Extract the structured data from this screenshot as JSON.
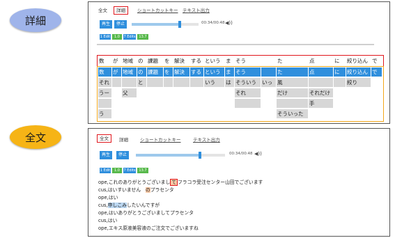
{
  "labels": {
    "detail": "詳細",
    "full": "全文"
  },
  "top": {
    "tabs": [
      "全文",
      "詳細",
      "ショートカットキー",
      "テキスト出力"
    ],
    "selected_tab": "詳細",
    "player": {
      "play": "再生",
      "stop": "停止",
      "time": "00:34/00:48",
      "progress": 0.72
    },
    "badges": [
      "1 Edit",
      "1.0 %",
      "7 Edits",
      "13.7 %"
    ],
    "tokens": [
      "数",
      "が",
      "地域",
      "の",
      "課題",
      "を",
      "解決",
      "する",
      "という",
      "ま",
      "そう",
      "",
      "た",
      "点",
      "に",
      "絞り込ん",
      "で"
    ],
    "grid": [
      [
        "数",
        "が",
        "地域",
        "の",
        "課題",
        "を",
        "解決",
        "する",
        "という",
        "ま",
        "そう",
        "",
        "た",
        "点",
        "に",
        "絞り込ん",
        "で"
      ],
      [
        "それ",
        "",
        "",
        "と",
        "",
        "",
        "",
        "",
        "いう",
        "は",
        "そういう",
        "いっ",
        "風",
        "",
        "",
        "絞り",
        ""
      ],
      [
        "うー",
        "",
        "父",
        "",
        "",
        "",
        "",
        "",
        "",
        "",
        "それ",
        "",
        "だけ",
        "それだけ",
        "",
        "",
        ""
      ],
      [
        "",
        "",
        "",
        "",
        "",
        "",
        "",
        "",
        "",
        "",
        "",
        "",
        "",
        "手",
        "",
        "",
        ""
      ],
      [
        "う",
        "",
        "",
        "",
        "",
        "",
        "",
        "",
        "",
        "",
        "",
        "",
        "そういった",
        "",
        "",
        "",
        ""
      ]
    ]
  },
  "bottom": {
    "tabs": [
      "全文",
      "詳細",
      "ショートカットキー",
      "テキスト出力"
    ],
    "selected_tab": "全文",
    "player": {
      "play": "再生",
      "stop": "停止",
      "time": "00:34/00:48",
      "progress": 0.72
    },
    "badges": [
      "1 Edit",
      "1.0 %",
      "7 Edits",
      "13.7 %"
    ],
    "lines": [
      {
        "a": "ope,これのありがとうございまし",
        "b": "て",
        "c": "フラコラ受注センター山田でございます"
      },
      {
        "a": "cus,はいすいません　",
        "b": "の",
        "c": "プラセンタ"
      },
      {
        "a": "ope,はい",
        "b": "",
        "c": ""
      },
      {
        "a": "cus,",
        "b": "申しこみ",
        "c": "したいんですが"
      },
      {
        "a": "ope,はいありがとうございましてプラセンタ",
        "b": "",
        "c": ""
      },
      {
        "a": "cus,はい",
        "b": "",
        "c": ""
      },
      {
        "a": "ope,エキス原液美容液のご注文でございますね",
        "b": "",
        "c": ""
      }
    ]
  }
}
